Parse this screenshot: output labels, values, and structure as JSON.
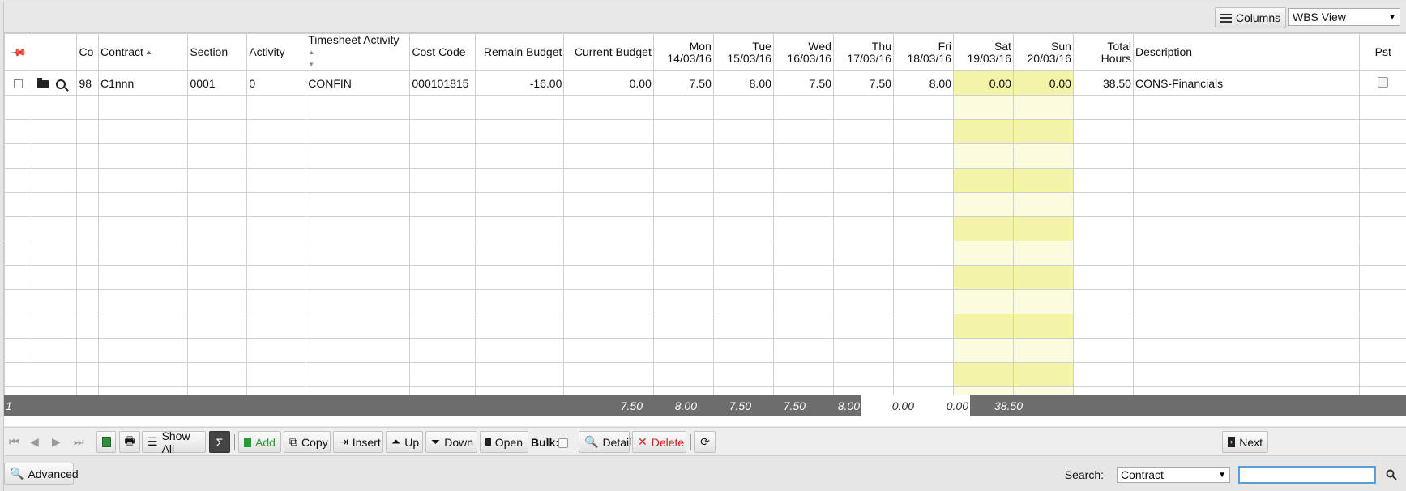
{
  "toolbar_top": {
    "columns_label": "Columns",
    "view_value": "WBS View"
  },
  "columns": {
    "co": "Co",
    "contract": "Contract",
    "section": "Section",
    "activity": "Activity",
    "timesheet_activity": "Timesheet Activity",
    "cost_code": "Cost Code",
    "remain_budget": "Remain Budget",
    "current_budget": "Current Budget",
    "mon": [
      "Mon",
      "14/03/16"
    ],
    "tue": [
      "Tue",
      "15/03/16"
    ],
    "wed": [
      "Wed",
      "16/03/16"
    ],
    "thu": [
      "Thu",
      "17/03/16"
    ],
    "fri": [
      "Fri",
      "18/03/16"
    ],
    "sat": [
      "Sat",
      "19/03/16"
    ],
    "sun": [
      "Sun",
      "20/03/16"
    ],
    "total": [
      "Total",
      "Hours"
    ],
    "description": "Description",
    "pst": "Pst"
  },
  "rows": [
    {
      "co": "98",
      "contract": "C1nnn",
      "section": "0001",
      "activity": "0",
      "timesheet_activity": "CONFIN",
      "cost_code": "000101815",
      "remain_budget": "-16.00",
      "current_budget": "0.00",
      "mon": "7.50",
      "tue": "8.00",
      "wed": "7.50",
      "thu": "7.50",
      "fri": "8.00",
      "sat": "0.00",
      "sun": "0.00",
      "total": "38.50",
      "description": "CONS-Financials"
    }
  ],
  "totals": {
    "count": "1",
    "mon": "7.50",
    "tue": "8.00",
    "wed": "7.50",
    "thu": "7.50",
    "fri": "8.00",
    "sat": "0.00",
    "sun": "0.00",
    "total": "38.50"
  },
  "toolbar": {
    "show_all": "Show All",
    "sigma": "Σ",
    "add": "Add",
    "copy": "Copy",
    "insert": "Insert",
    "up": "Up",
    "down": "Down",
    "open": "Open",
    "bulk": "Bulk:",
    "detail": "Detail",
    "delete": "Delete",
    "next": "Next"
  },
  "bottom": {
    "advanced": "Advanced",
    "search_label": "Search:",
    "search_field": "Contract",
    "search_value": ""
  }
}
